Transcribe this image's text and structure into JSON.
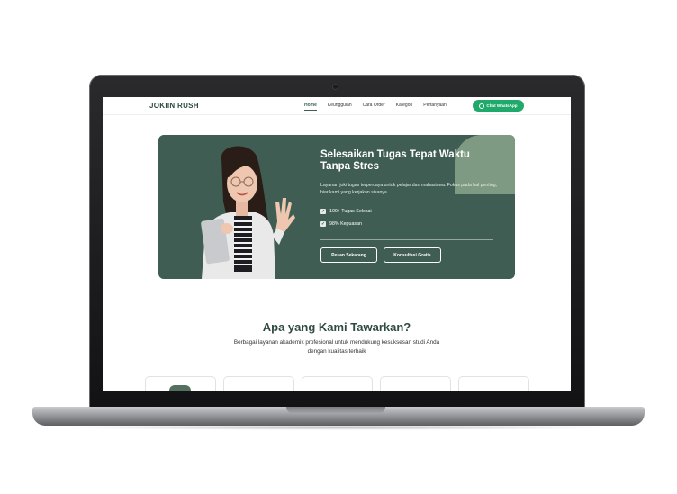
{
  "nav": {
    "brand": "JOKIIN RUSH",
    "links": [
      "Home",
      "Keunggulan",
      "Cara Order",
      "Kategori",
      "Pertanyaan"
    ],
    "active_index": 0,
    "whatsapp_label": "Chat WhatsApp"
  },
  "hero": {
    "title": "Selesaikan Tugas Tepat Waktu Tanpa Stres",
    "description": "Layanan joki tugas terpercaya untuk pelajar dan mahasiswa. Fokus pada hal penting, biar kami yang kerjakan sisanya.",
    "checks": [
      "100+ Tugas Selesai",
      "98% Kepuasan"
    ],
    "buttons": [
      "Pesan Sekarang",
      "Konsultasi Gratis"
    ]
  },
  "offer": {
    "title": "Apa yang Kami Tawarkan?",
    "subtitle": "Berbagai layanan akademik profesional untuk mendukung kesuksesan studi Anda dengan kualitas terbaik"
  },
  "colors": {
    "primary": "#3f5d52",
    "accent_blob": "#7e9a82",
    "whatsapp": "#1faa6b"
  },
  "icons": [
    "whatsapp-icon",
    "check-icon"
  ]
}
